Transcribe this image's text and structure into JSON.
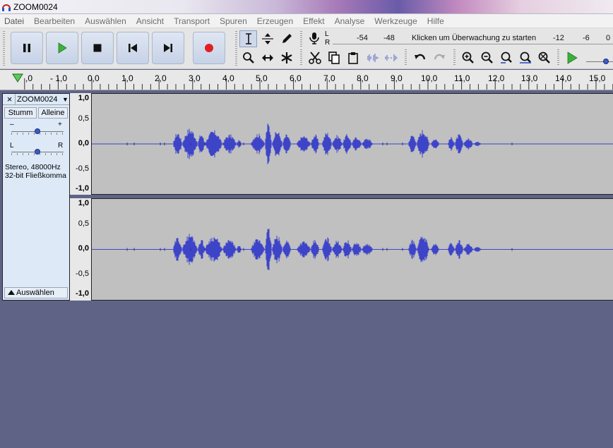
{
  "window": {
    "title": "ZOOM0024"
  },
  "menu": [
    "Datei",
    "Bearbeiten",
    "Auswählen",
    "Ansicht",
    "Transport",
    "Spuren",
    "Erzeugen",
    "Effekt",
    "Analyse",
    "Werkzeuge",
    "Hilfe"
  ],
  "transport": {
    "pause_icon": "pause-icon",
    "play_icon": "play-icon",
    "stop_icon": "stop-icon",
    "skip_start_icon": "skip-to-start-icon",
    "skip_end_icon": "skip-to-end-icon",
    "record_icon": "record-icon"
  },
  "meter": {
    "channel_l": "L",
    "channel_r": "R",
    "scale": [
      "-54",
      "-48",
      "-12",
      "-6",
      "0"
    ],
    "message": "Klicken um Überwachung zu starten"
  },
  "ruler": {
    "labels": [
      ",0",
      "- 1,0",
      "0,0",
      "1,0",
      "2,0",
      "3,0",
      "4,0",
      "5,0",
      "6,0",
      "7,0",
      "8,0",
      "9,0",
      "10,0",
      "11,0",
      "12,0",
      "13,0",
      "14,0",
      "15,0"
    ]
  },
  "track": {
    "name": "ZOOM0024",
    "mute": "Stumm",
    "solo": "Alleine",
    "gain_minus": "–",
    "gain_plus": "+",
    "pan_l": "L",
    "pan_r": "R",
    "gain_level": 0.5,
    "pan_level": 0.5,
    "format_line1": "Stereo, 48000Hz",
    "format_line2": "32-bit Fließkomma",
    "select_button": "Auswählen"
  },
  "amplitude_ruler": [
    "1,0",
    "0,5",
    "0,0",
    "-0,5",
    "-1,0"
  ],
  "colors": {
    "waveform": "#3d44c8",
    "waveform_dark": "#2a2fa0",
    "track_bg": "#c0c0c0",
    "workspace": "#5f6487"
  }
}
